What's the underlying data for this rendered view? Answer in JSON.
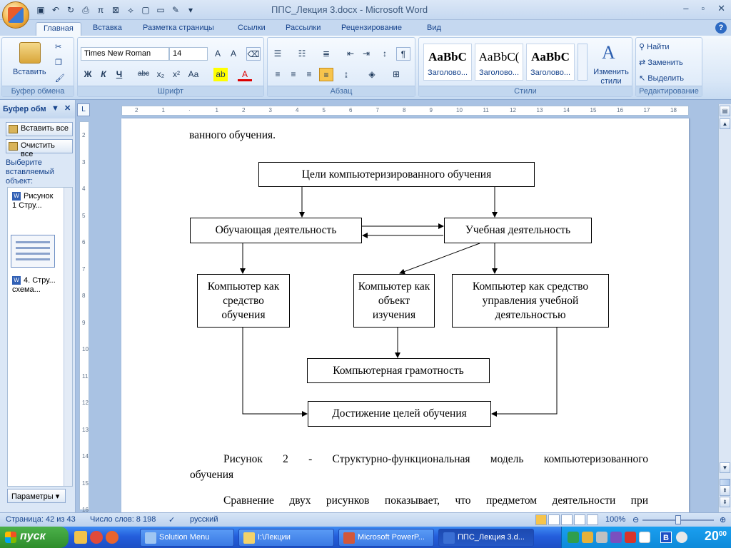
{
  "window": {
    "title": "ППС_Лекция 3.docx - Microsoft Word"
  },
  "tabs": [
    "Главная",
    "Вставка",
    "Разметка страницы",
    "Ссылки",
    "Рассылки",
    "Рецензирование",
    "Вид"
  ],
  "ribbon": {
    "clipboard": {
      "paste": "Вставить",
      "label": "Буфер обмена"
    },
    "font": {
      "name": "Times New Roman",
      "size": "14",
      "label": "Шрифт"
    },
    "paragraph": {
      "label": "Абзац"
    },
    "styles": {
      "label": "Стили",
      "change": "Изменить стили",
      "tiles": [
        {
          "sample": "AaBbC",
          "name": "Заголово..."
        },
        {
          "sample": "AaBbC(",
          "name": "Заголово..."
        },
        {
          "sample": "AaBbC",
          "name": "Заголово..."
        }
      ]
    },
    "editing": {
      "find": "Найти",
      "replace": "Заменить",
      "select": "Выделить",
      "label": "Редактирование"
    }
  },
  "pane": {
    "title": "Буфер обм",
    "paste_all": "Вставить все",
    "clear_all": "Очистить все",
    "hint": "Выберите вставляемый объект:",
    "items": [
      {
        "text": "Рисунок 1 Стру..."
      },
      {
        "text": "4. Стру... схема..."
      }
    ],
    "params": "Параметры"
  },
  "document": {
    "top_text": "ванного обучения.",
    "diagram": {
      "goals": "Цели компьютеризированного обучения",
      "teaching": "Обучающая деятельность",
      "learning": "Учебная деятельность",
      "tool": "Компьютер как средство обучения",
      "object": "Компьютер как объект изучения",
      "manage": "Компьютер как средство управления учебной деятельностью",
      "literacy": "Компьютерная грамотность",
      "achieve": "Достижение целей обучения"
    },
    "caption_line1": "Рисунок 2 - Структурно-функциональная модель компьютеризованного",
    "caption_line2": "обучения",
    "next_text": "Сравнение двух рисунков показывает, что предметом деятельности при"
  },
  "status": {
    "page": "Страница: 42 из 43",
    "words": "Число слов: 8 198",
    "lang": "русский",
    "zoom": "100%"
  },
  "taskbar": {
    "start": "пуск",
    "tasks": [
      "Solution Menu",
      "I:\\Лекции",
      "Microsoft PowerP...",
      "ППС_Лекция 3.d..."
    ],
    "lang_indicator": "В",
    "time_hour": "20",
    "time_min": "00"
  },
  "colors": {
    "accent": "#15428b",
    "ribbon": "#dbe7f7",
    "taskbar": "#245edc",
    "start": "#2e8d2b"
  }
}
